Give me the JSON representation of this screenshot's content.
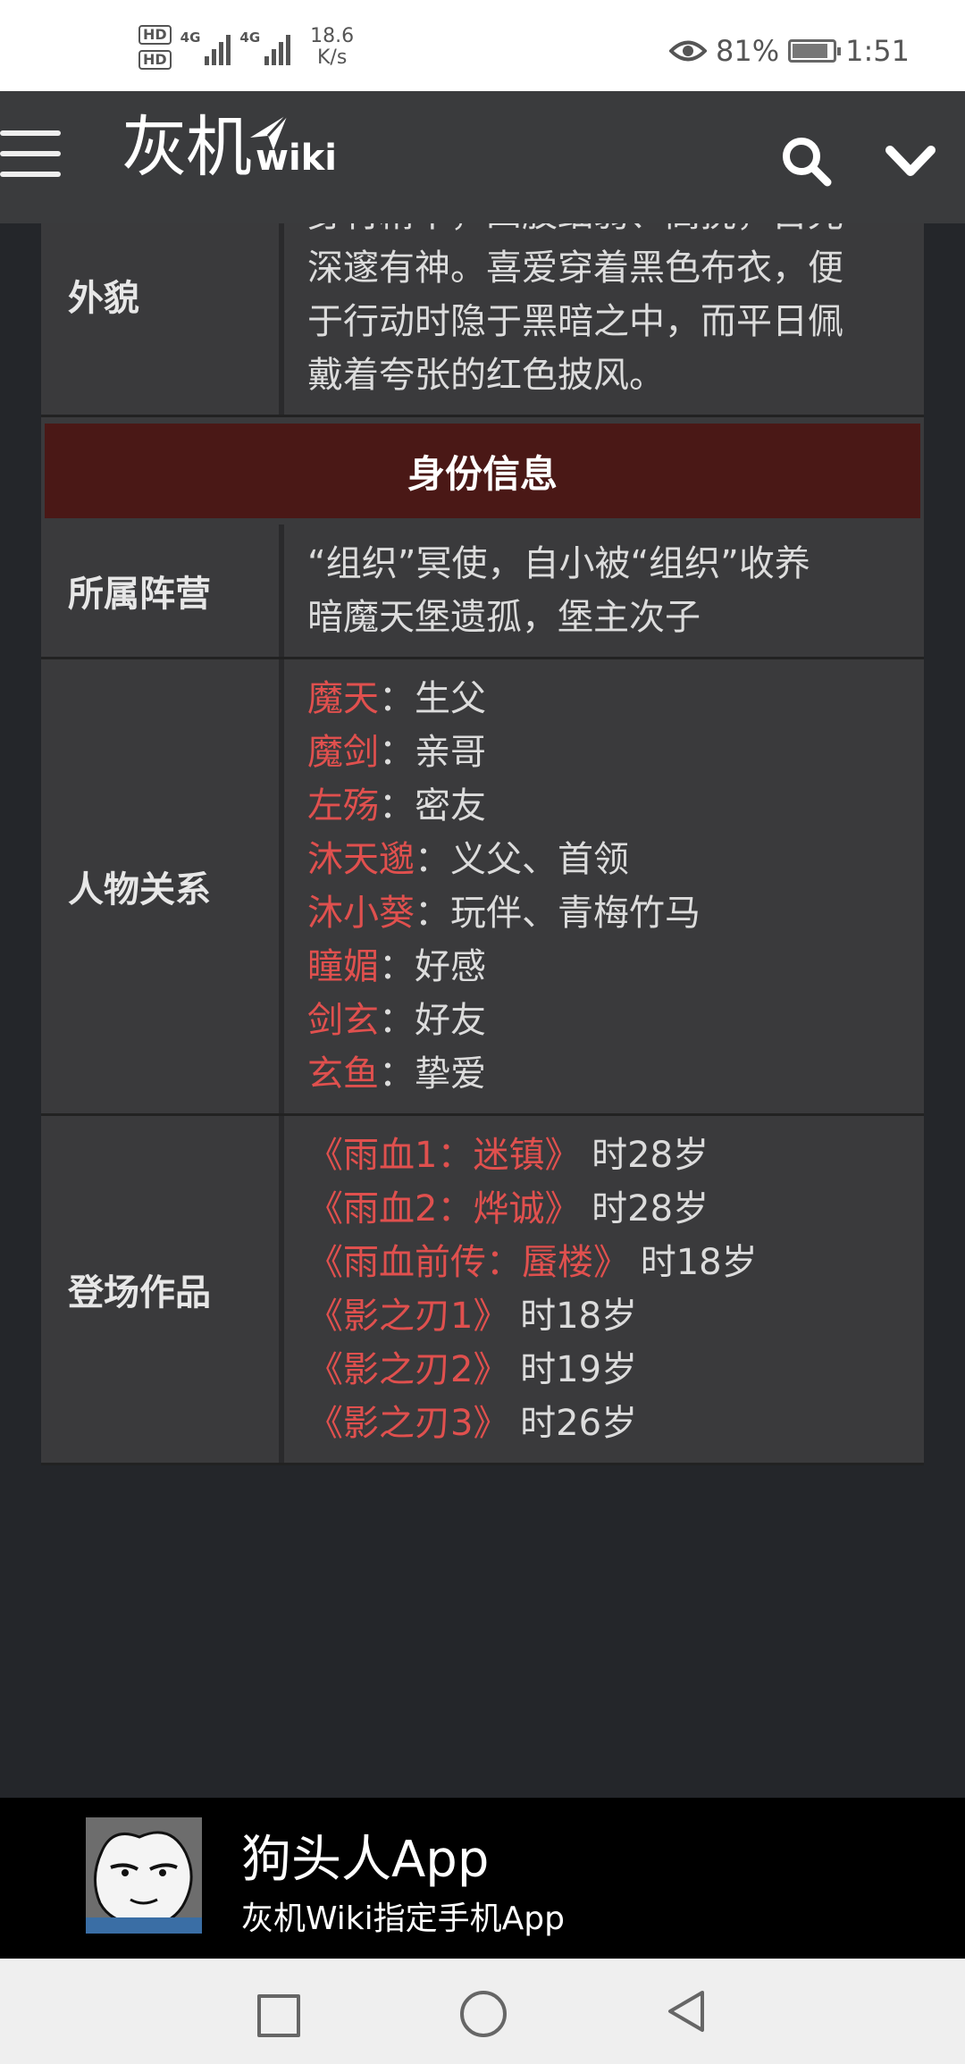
{
  "status_bar": {
    "hd1": "HD",
    "hd2": "HD",
    "sig1": "4G",
    "sig2": "4G",
    "speed_value": "18.6",
    "speed_unit": "K/s",
    "battery": "81%",
    "battery_level": 0.81,
    "time": "1:51"
  },
  "header": {
    "logo_cn": "灰机",
    "logo_en": "wiki"
  },
  "table": {
    "appearance": {
      "label": "外貌",
      "lines": [
        "身材精干，四肢细弱、高挑，目光",
        "深邃有神。喜爱穿着黑色布衣，便",
        "于行动时隐于黑暗之中，而平日佩",
        "戴着夸张的红色披风。"
      ]
    },
    "section_title": "身份信息",
    "faction": {
      "label": "所属阵营",
      "lines": [
        "“组织”冥使，自小被“组织”收养",
        "暗魔天堡遗孤，堡主次子"
      ]
    },
    "relations": {
      "label": "人物关系",
      "items": [
        {
          "name": "魔天",
          "desc": "：生父"
        },
        {
          "name": "魔剑",
          "desc": "：亲哥"
        },
        {
          "name": "左殇",
          "desc": "：密友"
        },
        {
          "name": "沐天邈",
          "desc": "：义父、首领"
        },
        {
          "name": "沐小葵",
          "desc": "：玩伴、青梅竹马"
        },
        {
          "name": "瞳媚",
          "desc": "：好感"
        },
        {
          "name": "剑玄",
          "desc": "：好友"
        },
        {
          "name": "玄鱼",
          "desc": "：挚爱"
        }
      ]
    },
    "works": {
      "label": "登场作品",
      "items": [
        {
          "title": "《雨血1：迷镇》",
          "desc": "时28岁"
        },
        {
          "title": "《雨血2：烨诚》",
          "desc": "时28岁"
        },
        {
          "title": "《雨血前传：蜃楼》",
          "desc": "时18岁"
        },
        {
          "title": "《影之刃1》",
          "desc": "时18岁"
        },
        {
          "title": "《影之刃2》",
          "desc": "时19岁"
        },
        {
          "title": "《影之刃3》",
          "desc": "时26岁"
        }
      ]
    }
  },
  "app_banner": {
    "title": "狗头人App",
    "subtitle": "灰机Wiki指定手机App"
  }
}
